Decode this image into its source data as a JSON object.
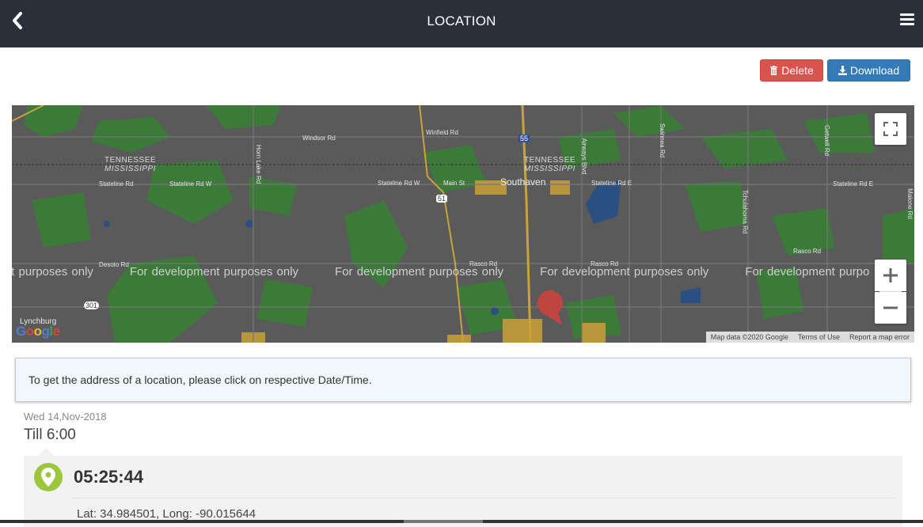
{
  "header": {
    "title": "LOCATION",
    "back_icon": "chevron-left-icon",
    "menu_icon": "hamburger-menu-icon"
  },
  "toolbar": {
    "delete_label": "Delete",
    "download_label": "Download",
    "delete_color": "#d9534f",
    "download_color": "#337ab7"
  },
  "map": {
    "watermark": [
      "ment purposes only",
      "For development purposes only",
      "For development purposes only",
      "For development purposes only",
      "For development purpo"
    ],
    "city": "Southaven",
    "state_north": "TENNESSEE",
    "state_south": "MISSISSIPPI",
    "labels": {
      "windsor": "Windsor Rd",
      "winfield": "Winfield Rd",
      "stateline1": "Stateline Rd",
      "stateline2": "Stateline Rd W",
      "stateline3": "Stateline Rd W",
      "stateline4": "Stateline Rd E",
      "stateline5": "Stateline Rd E",
      "main": "Main St",
      "horn_lake": "Horn Lake Rd",
      "airways": "Airways Blvd",
      "swinnea": "Swinnea Rd",
      "getwell": "Getwell Rd",
      "tchula": "Tchulahoma Rd",
      "malone": "Malone Rd",
      "desoto": "Desoto Rd",
      "rasco1": "Rasco Rd",
      "rasco2": "Rasco Rd",
      "rasco3": "Rasco Rd",
      "lynchburg": "Lynchburg",
      "hwy55": "55",
      "hwy51": "51",
      "hwy301": "301"
    },
    "attribution": {
      "data": "Map data ©2020 Google",
      "terms": "Terms of Use",
      "report": "Report a map error"
    },
    "logo": "Google"
  },
  "info_text": "To get the address of a location, please click on respective Date/Time.",
  "entry": {
    "date": "Wed 14,Nov-2018",
    "till": "Till 6:00",
    "time": "05:25:44",
    "coords": "Lat: 34.984501, Long: -90.015644",
    "pin_color": "#9dc73a"
  }
}
